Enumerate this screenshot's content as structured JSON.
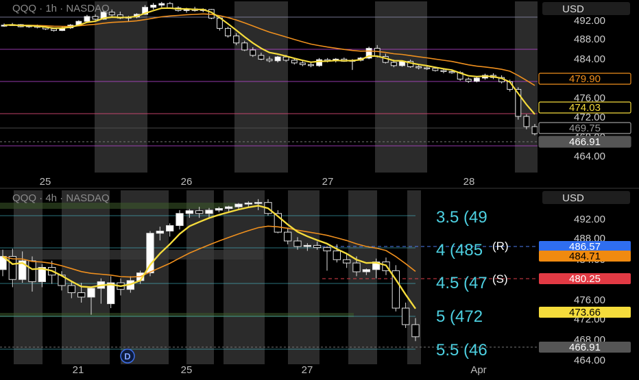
{
  "chart_data": [
    {
      "type": "candlestick",
      "title": "QQQ · 1h · NASDAQ",
      "currency": "USD",
      "x_labels": [
        "25",
        "26",
        "27",
        "28"
      ],
      "y_ticks": [
        "492.00",
        "488.00",
        "484.00",
        "480.00",
        "476.00",
        "472.00",
        "468.00",
        "464.00"
      ],
      "price_tags": [
        {
          "value": "479.90",
          "style": "outline-orange"
        },
        {
          "value": "474.03",
          "style": "outline-yellow"
        },
        {
          "value": "469.75",
          "style": "outline-gray"
        },
        {
          "value": "466.91",
          "style": "fill-gray"
        }
      ],
      "candles": [
        [
          489.8,
          490.2,
          489.6,
          489.9
        ],
        [
          489.9,
          490.3,
          489.8,
          490.0
        ],
        [
          490.0,
          490.1,
          489.5,
          489.6
        ],
        [
          489.6,
          489.9,
          489.4,
          489.8
        ],
        [
          489.8,
          490.0,
          489.3,
          489.5
        ],
        [
          489.5,
          489.7,
          489.0,
          489.2
        ],
        [
          489.2,
          489.4,
          488.7,
          488.9
        ],
        [
          488.9,
          489.6,
          488.8,
          489.4
        ],
        [
          489.4,
          490.1,
          489.2,
          489.9
        ],
        [
          489.9,
          490.8,
          489.8,
          490.6
        ],
        [
          490.6,
          491.8,
          490.4,
          491.5
        ],
        [
          491.5,
          491.9,
          490.8,
          491.0
        ],
        [
          491.0,
          492.6,
          490.9,
          492.3
        ],
        [
          492.3,
          492.8,
          491.5,
          491.8
        ],
        [
          491.8,
          492.4,
          491.0,
          491.2
        ],
        [
          491.2,
          491.6,
          490.6,
          491.4
        ],
        [
          491.4,
          492.1,
          491.2,
          491.9
        ],
        [
          491.9,
          493.6,
          491.8,
          493.2
        ],
        [
          493.2,
          494.0,
          492.8,
          493.6
        ],
        [
          493.6,
          494.2,
          493.2,
          493.9
        ],
        [
          493.9,
          494.2,
          492.9,
          493.1
        ],
        [
          493.1,
          493.4,
          492.4,
          492.6
        ],
        [
          492.6,
          493.1,
          492.2,
          492.9
        ],
        [
          492.9,
          493.3,
          492.4,
          492.6
        ],
        [
          492.6,
          493.0,
          492.3,
          492.8
        ],
        [
          492.8,
          492.9,
          491.0,
          491.2
        ],
        [
          491.2,
          491.5,
          488.9,
          489.3
        ],
        [
          489.3,
          489.6,
          487.6,
          487.9
        ],
        [
          487.9,
          488.4,
          486.2,
          486.6
        ],
        [
          486.6,
          487.0,
          485.1,
          485.3
        ],
        [
          485.3,
          485.8,
          484.0,
          484.3
        ],
        [
          484.3,
          484.8,
          483.4,
          483.6
        ],
        [
          483.6,
          484.1,
          483.0,
          483.3
        ],
        [
          483.3,
          484.2,
          483.0,
          484.0
        ],
        [
          484.0,
          484.4,
          483.1,
          483.4
        ],
        [
          483.4,
          483.8,
          482.6,
          482.9
        ],
        [
          482.9,
          483.3,
          482.3,
          482.6
        ],
        [
          482.6,
          483.1,
          482.1,
          482.4
        ],
        [
          482.4,
          483.8,
          482.2,
          483.5
        ],
        [
          483.5,
          483.8,
          483.0,
          483.3
        ],
        [
          483.3,
          483.8,
          483.0,
          483.6
        ],
        [
          483.6,
          483.9,
          483.1,
          483.2
        ],
        [
          483.2,
          483.6,
          481.6,
          483.4
        ],
        [
          483.4,
          484.0,
          483.2,
          483.8
        ],
        [
          483.8,
          485.9,
          483.6,
          485.6
        ],
        [
          485.6,
          486.2,
          483.9,
          484.1
        ],
        [
          484.1,
          484.6,
          482.8,
          483.0
        ],
        [
          483.0,
          483.5,
          482.1,
          482.4
        ],
        [
          482.4,
          483.4,
          482.2,
          483.2
        ],
        [
          483.2,
          483.5,
          482.0,
          482.2
        ],
        [
          482.2,
          482.6,
          481.7,
          482.0
        ],
        [
          482.0,
          482.4,
          481.6,
          481.9
        ],
        [
          481.9,
          482.2,
          481.3,
          481.5
        ],
        [
          481.5,
          481.8,
          481.0,
          481.3
        ],
        [
          481.3,
          481.7,
          480.9,
          481.1
        ],
        [
          481.1,
          481.4,
          479.6,
          479.9
        ],
        [
          479.9,
          480.2,
          479.2,
          479.5
        ],
        [
          479.5,
          480.3,
          479.3,
          480.1
        ],
        [
          480.1,
          480.9,
          479.8,
          480.6
        ],
        [
          480.6,
          481.0,
          479.9,
          480.2
        ],
        [
          480.2,
          480.6,
          479.1,
          479.4
        ],
        [
          479.4,
          479.8,
          477.6,
          478.0
        ],
        [
          478.0,
          478.4,
          472.4,
          473.0
        ],
        [
          473.0,
          473.4,
          470.6,
          471.1
        ],
        [
          471.1,
          471.6,
          469.5,
          469.8
        ]
      ],
      "day_shading": [
        "black",
        "gray",
        "black",
        "gray",
        "black",
        "gray",
        "black"
      ]
    },
    {
      "type": "candlestick",
      "title": "QQQ · 4h · NASDAQ",
      "currency": "USD",
      "x_labels": [
        "21",
        "25",
        "27",
        "Apr"
      ],
      "y_ticks": [
        "492.00",
        "488.00",
        "484.00",
        "480.00",
        "476.00",
        "472.00",
        "468.00",
        "464.00"
      ],
      "level_labels": [
        {
          "text": "3.5 (49",
          "color": "#4dd0e1"
        },
        {
          "text": "4 (485",
          "color": "#4dd0e1"
        },
        {
          "text": "4.5 (47",
          "color": "#4dd0e1"
        },
        {
          "text": "5 (472",
          "color": "#4dd0e1"
        },
        {
          "text": "5.5 (46",
          "color": "#4dd0e1"
        },
        {
          "text": "(R)",
          "color": "#ffffff"
        },
        {
          "text": "(S)",
          "color": "#ffffff"
        }
      ],
      "price_tags": [
        {
          "value": "486.57",
          "style": "fill-blue"
        },
        {
          "value": "484.71",
          "style": "fill-orange"
        },
        {
          "value": "480.25",
          "style": "fill-red"
        },
        {
          "value": "473.66",
          "style": "fill-yellow"
        },
        {
          "value": "466.91",
          "style": "fill-gray"
        }
      ],
      "badge": "D",
      "candles": [
        [
          480.2,
          483.8,
          479.0,
          482.6
        ],
        [
          482.6,
          484.0,
          477.0,
          478.4
        ],
        [
          478.4,
          483.5,
          477.8,
          481.8
        ],
        [
          481.8,
          482.6,
          476.2,
          478.0
        ],
        [
          478.0,
          481.2,
          477.0,
          480.6
        ],
        [
          480.6,
          481.8,
          477.6,
          479.2
        ],
        [
          479.2,
          479.9,
          476.4,
          477.3
        ],
        [
          477.3,
          478.0,
          475.0,
          476.0
        ],
        [
          476.0,
          477.8,
          474.2,
          475.2
        ],
        [
          475.2,
          477.0,
          472.0,
          476.8
        ],
        [
          476.8,
          478.6,
          474.0,
          478.0
        ],
        [
          474.0,
          479.0,
          473.2,
          477.8
        ],
        [
          477.8,
          478.6,
          475.5,
          476.6
        ],
        [
          476.6,
          479.0,
          476.0,
          478.2
        ],
        [
          478.2,
          480.0,
          477.6,
          479.6
        ],
        [
          479.6,
          487.2,
          479.0,
          486.8
        ],
        [
          486.8,
          488.0,
          485.5,
          487.2
        ],
        [
          487.2,
          488.6,
          486.2,
          488.2
        ],
        [
          488.2,
          491.0,
          487.5,
          490.4
        ],
        [
          490.4,
          491.2,
          489.6,
          490.9
        ],
        [
          490.9,
          491.6,
          489.6,
          490.4
        ],
        [
          490.4,
          491.4,
          489.4,
          491.0
        ],
        [
          491.0,
          491.6,
          490.6,
          491.3
        ],
        [
          491.3,
          491.8,
          490.6,
          491.6
        ],
        [
          491.6,
          492.3,
          491.0,
          492.1
        ],
        [
          492.1,
          492.6,
          491.4,
          492.3
        ],
        [
          492.3,
          493.0,
          491.0,
          492.4
        ],
        [
          492.4,
          493.0,
          490.0,
          490.4
        ],
        [
          490.4,
          491.0,
          486.8,
          487.0
        ],
        [
          487.0,
          487.8,
          484.8,
          485.4
        ],
        [
          485.4,
          486.1,
          483.8,
          484.4
        ],
        [
          484.4,
          485.0,
          483.6,
          484.6
        ],
        [
          484.6,
          485.3,
          483.8,
          484.2
        ],
        [
          484.2,
          484.5,
          480.0,
          483.6
        ],
        [
          483.6,
          484.8,
          481.5,
          482.0
        ],
        [
          482.0,
          483.0,
          480.5,
          481.4
        ],
        [
          481.4,
          482.6,
          479.0,
          479.8
        ],
        [
          479.8,
          480.4,
          479.2,
          480.2
        ],
        [
          480.2,
          482.2,
          478.6,
          481.6
        ],
        [
          481.6,
          482.4,
          479.2,
          480.0
        ],
        [
          480.0,
          481.0,
          472.6,
          473.2
        ],
        [
          473.2,
          474.2,
          469.6,
          470.2
        ],
        [
          470.2,
          471.4,
          467.2,
          468.0
        ]
      ],
      "day_shading": [
        "black",
        "gray",
        "black",
        "gray",
        "black",
        "gray",
        "black",
        "gray",
        "black",
        "gray",
        "black",
        "gray",
        "black",
        "gray",
        "black"
      ]
    }
  ]
}
